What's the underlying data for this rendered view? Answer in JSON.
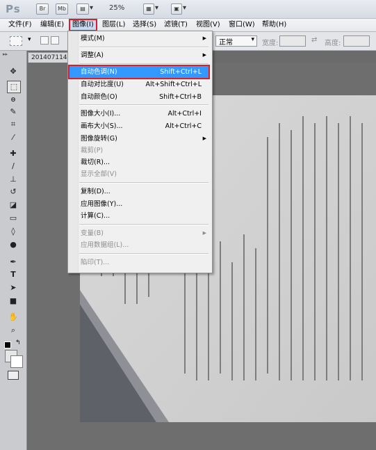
{
  "titlebar": {
    "logo": "Ps",
    "br": "Br",
    "mb": "Mb",
    "zoom": "25%"
  },
  "menubar": {
    "items": [
      "文件(F)",
      "编辑(E)",
      "图像(I)",
      "图层(L)",
      "选择(S)",
      "滤镜(T)",
      "视图(V)",
      "窗口(W)",
      "帮助(H)"
    ]
  },
  "options": {
    "mode_value": "正常",
    "width_label": "宽度:",
    "height_label": "高度:"
  },
  "document": {
    "tab_label": "201407114"
  },
  "image_menu": {
    "mode": "模式(M)",
    "adjust": "调整(A)",
    "auto_tone": "自动色调(N)",
    "auto_tone_sc": "Shift+Ctrl+L",
    "auto_contrast": "自动对比度(U)",
    "auto_contrast_sc": "Alt+Shift+Ctrl+L",
    "auto_color": "自动颜色(O)",
    "auto_color_sc": "Shift+Ctrl+B",
    "image_size": "图像大小(I)...",
    "image_size_sc": "Alt+Ctrl+I",
    "canvas_size": "画布大小(S)...",
    "canvas_size_sc": "Alt+Ctrl+C",
    "rotation": "图像旋转(G)",
    "crop": "裁剪(P)",
    "trim": "裁切(R)...",
    "reveal_all": "显示全部(V)",
    "duplicate": "复制(D)...",
    "apply_image": "应用图像(Y)...",
    "calculations": "计算(C)...",
    "variables": "变量(B)",
    "apply_data_set": "应用数据组(L)...",
    "trap": "陷印(T)..."
  },
  "colors": {
    "highlight": "#3399ff",
    "annotation": "#d8202a"
  }
}
